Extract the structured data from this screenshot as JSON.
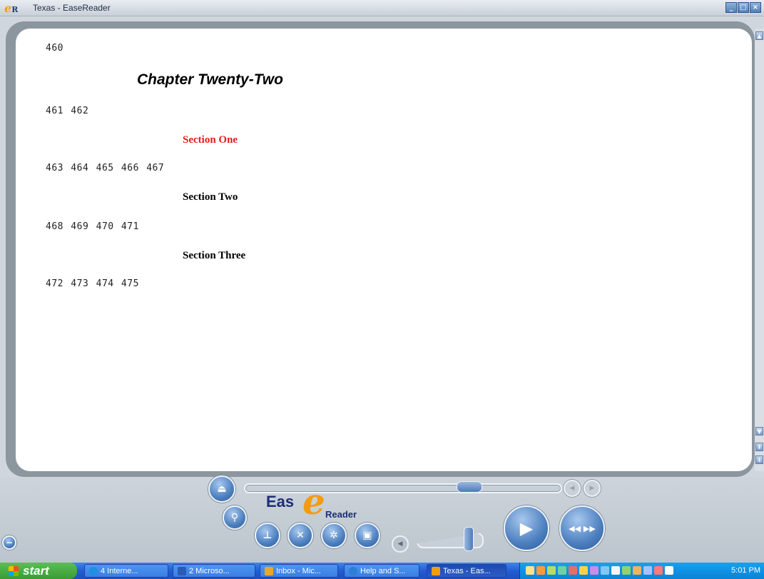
{
  "window": {
    "logo_letter": "e",
    "logo_sub": "R",
    "title": "Texas - EaseReader",
    "min_glyph": "_",
    "max_glyph": "□",
    "close_glyph": "×"
  },
  "document": {
    "page_first": "460",
    "chapter_heading": "Chapter Twenty-Two",
    "pages_after_chapter": "461 462",
    "sections": [
      {
        "title": "Section One",
        "pages": "463 464 465 466 467",
        "active": true
      },
      {
        "title": "Section Two",
        "pages": "468 469 470 471",
        "active": false
      },
      {
        "title": "Section Three",
        "pages": "472 473 474 475",
        "active": false
      }
    ]
  },
  "player": {
    "logo_left": "Eas",
    "logo_e": "e",
    "logo_right": "Reader",
    "progress": 0.73,
    "volume": 0.85,
    "icons": {
      "eject": "eject-icon",
      "search": "search-icon",
      "bookmark": "pin-icon",
      "tools": "tools-icon",
      "navigate": "helm-icon",
      "window": "window-icon",
      "play": "play-icon",
      "skip": "skip-directions-icon"
    }
  },
  "taskbar": {
    "start_label": "start",
    "tasks": [
      {
        "label": "4 Interne...",
        "icon_color": "#1f8fe0"
      },
      {
        "label": "2 Microso...",
        "icon_color": "#2b5bb8"
      },
      {
        "label": "Inbox - Mic...",
        "icon_color": "#e6a92b"
      },
      {
        "label": "Help and S...",
        "icon_color": "#2d7fd6"
      },
      {
        "label": "Texas - Eas...",
        "icon_color": "#f39c12"
      }
    ],
    "clock": "5:01 PM"
  }
}
